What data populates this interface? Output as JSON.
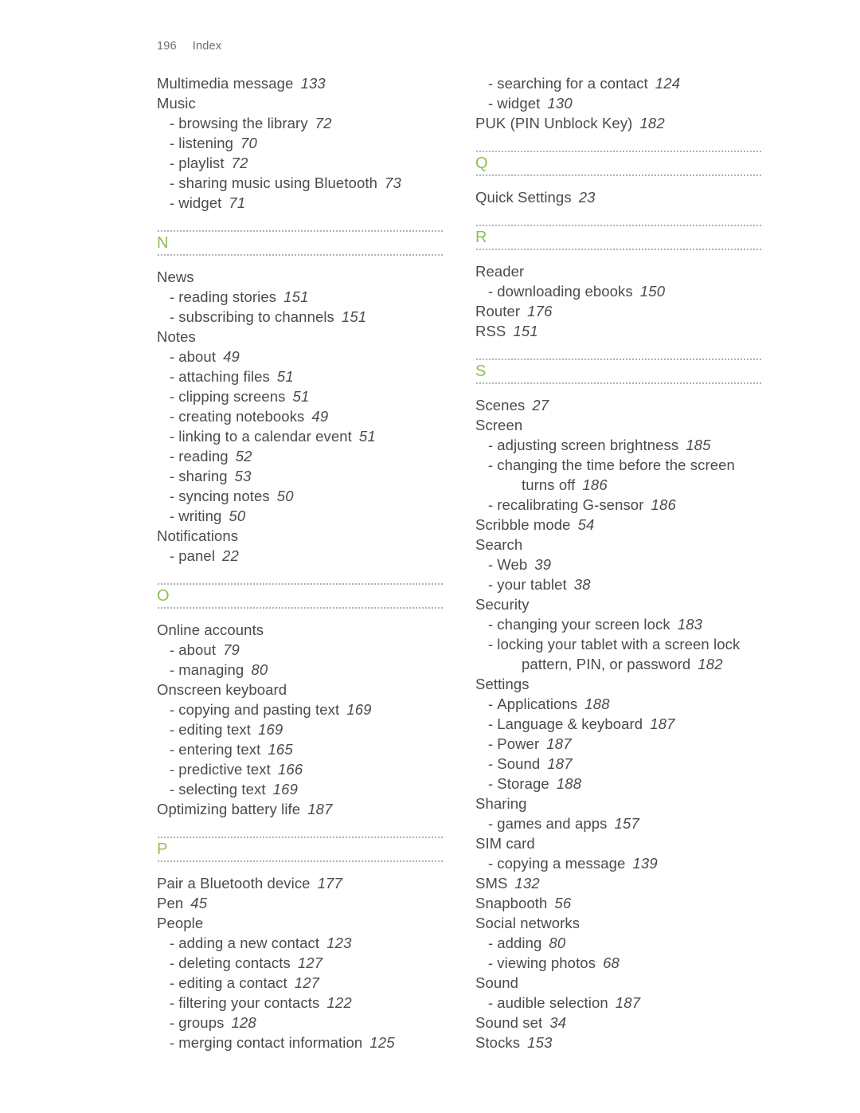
{
  "header": {
    "folio": "196",
    "title": "Index"
  },
  "theme": {
    "letter_color": "#8cc152",
    "text_color": "#4b4b4b",
    "header_color": "#6f6f6f",
    "rule_color": "#6b6b6b"
  },
  "columns": [
    {
      "name": "left-column",
      "blocks": [
        {
          "type": "entries",
          "entries": [
            {
              "level": "main",
              "text": "Multimedia message",
              "page": "133"
            },
            {
              "level": "main",
              "text": "Music",
              "page": ""
            },
            {
              "level": "sub",
              "text": "browsing the library",
              "page": "72"
            },
            {
              "level": "sub",
              "text": "listening",
              "page": "70"
            },
            {
              "level": "sub",
              "text": "playlist",
              "page": "72"
            },
            {
              "level": "sub",
              "text": "sharing music using Bluetooth",
              "page": "73"
            },
            {
              "level": "sub",
              "text": "widget",
              "page": "71"
            }
          ]
        },
        {
          "type": "letter",
          "letter": "N"
        },
        {
          "type": "entries",
          "entries": [
            {
              "level": "main",
              "text": "News",
              "page": ""
            },
            {
              "level": "sub",
              "text": "reading stories",
              "page": "151"
            },
            {
              "level": "sub",
              "text": "subscribing to channels",
              "page": "151"
            },
            {
              "level": "main",
              "text": "Notes",
              "page": ""
            },
            {
              "level": "sub",
              "text": "about",
              "page": "49"
            },
            {
              "level": "sub",
              "text": "attaching files",
              "page": "51"
            },
            {
              "level": "sub",
              "text": "clipping screens",
              "page": "51"
            },
            {
              "level": "sub",
              "text": "creating notebooks",
              "page": "49"
            },
            {
              "level": "sub",
              "text": "linking to a calendar event",
              "page": "51"
            },
            {
              "level": "sub",
              "text": "reading",
              "page": "52"
            },
            {
              "level": "sub",
              "text": "sharing",
              "page": "53"
            },
            {
              "level": "sub",
              "text": "syncing notes",
              "page": "50"
            },
            {
              "level": "sub",
              "text": "writing",
              "page": "50"
            },
            {
              "level": "main",
              "text": "Notifications",
              "page": ""
            },
            {
              "level": "sub",
              "text": "panel",
              "page": "22"
            }
          ]
        },
        {
          "type": "letter",
          "letter": "O"
        },
        {
          "type": "entries",
          "entries": [
            {
              "level": "main",
              "text": "Online accounts",
              "page": ""
            },
            {
              "level": "sub",
              "text": "about",
              "page": "79"
            },
            {
              "level": "sub",
              "text": "managing",
              "page": "80"
            },
            {
              "level": "main",
              "text": "Onscreen keyboard",
              "page": ""
            },
            {
              "level": "sub",
              "text": "copying and pasting text",
              "page": "169"
            },
            {
              "level": "sub",
              "text": "editing text",
              "page": "169"
            },
            {
              "level": "sub",
              "text": "entering text",
              "page": "165"
            },
            {
              "level": "sub",
              "text": "predictive text",
              "page": "166"
            },
            {
              "level": "sub",
              "text": "selecting text",
              "page": "169"
            },
            {
              "level": "main",
              "text": "Optimizing battery life",
              "page": "187"
            }
          ]
        },
        {
          "type": "letter",
          "letter": "P"
        },
        {
          "type": "entries",
          "entries": [
            {
              "level": "main",
              "text": "Pair a Bluetooth device",
              "page": "177"
            },
            {
              "level": "main",
              "text": "Pen",
              "page": "45"
            },
            {
              "level": "main",
              "text": "People",
              "page": ""
            },
            {
              "level": "sub",
              "text": "adding a new contact",
              "page": "123"
            },
            {
              "level": "sub",
              "text": "deleting contacts",
              "page": "127"
            },
            {
              "level": "sub",
              "text": "editing a contact",
              "page": "127"
            },
            {
              "level": "sub",
              "text": "filtering your contacts",
              "page": "122"
            },
            {
              "level": "sub",
              "text": "groups",
              "page": "128"
            },
            {
              "level": "sub",
              "text": "merging contact information",
              "page": "125"
            }
          ]
        }
      ]
    },
    {
      "name": "right-column",
      "blocks": [
        {
          "type": "entries",
          "entries": [
            {
              "level": "sub",
              "text": "searching for a contact",
              "page": "124"
            },
            {
              "level": "sub",
              "text": "widget",
              "page": "130"
            },
            {
              "level": "main",
              "text": "PUK (PIN Unblock Key)",
              "page": "182"
            }
          ]
        },
        {
          "type": "letter",
          "letter": "Q"
        },
        {
          "type": "entries",
          "entries": [
            {
              "level": "main",
              "text": "Quick Settings",
              "page": "23"
            }
          ]
        },
        {
          "type": "letter",
          "letter": "R"
        },
        {
          "type": "entries",
          "entries": [
            {
              "level": "main",
              "text": "Reader",
              "page": ""
            },
            {
              "level": "sub",
              "text": "downloading ebooks",
              "page": "150"
            },
            {
              "level": "main",
              "text": "Router",
              "page": "176"
            },
            {
              "level": "main",
              "text": "RSS",
              "page": "151"
            }
          ]
        },
        {
          "type": "letter",
          "letter": "S"
        },
        {
          "type": "entries",
          "entries": [
            {
              "level": "main",
              "text": "Scenes",
              "page": "27"
            },
            {
              "level": "main",
              "text": "Screen",
              "page": ""
            },
            {
              "level": "sub",
              "text": "adjusting screen brightness",
              "page": "185"
            },
            {
              "level": "sub",
              "text": "changing the time before the screen",
              "page": ""
            },
            {
              "level": "cont",
              "text": "turns off",
              "page": "186"
            },
            {
              "level": "sub",
              "text": "recalibrating G-sensor",
              "page": "186"
            },
            {
              "level": "main",
              "text": "Scribble mode",
              "page": "54"
            },
            {
              "level": "main",
              "text": "Search",
              "page": ""
            },
            {
              "level": "sub",
              "text": "Web",
              "page": "39"
            },
            {
              "level": "sub",
              "text": "your tablet",
              "page": "38"
            },
            {
              "level": "main",
              "text": "Security",
              "page": ""
            },
            {
              "level": "sub",
              "text": "changing your screen lock",
              "page": "183"
            },
            {
              "level": "sub",
              "text": "locking your tablet with a screen lock",
              "page": ""
            },
            {
              "level": "cont",
              "text": "pattern, PIN, or password",
              "page": "182"
            },
            {
              "level": "main",
              "text": "Settings",
              "page": ""
            },
            {
              "level": "sub",
              "text": "Applications",
              "page": "188"
            },
            {
              "level": "sub",
              "text": "Language & keyboard",
              "page": "187"
            },
            {
              "level": "sub",
              "text": "Power",
              "page": "187"
            },
            {
              "level": "sub",
              "text": "Sound",
              "page": "187"
            },
            {
              "level": "sub",
              "text": "Storage",
              "page": "188"
            },
            {
              "level": "main",
              "text": "Sharing",
              "page": ""
            },
            {
              "level": "sub",
              "text": "games and apps",
              "page": "157"
            },
            {
              "level": "main",
              "text": "SIM card",
              "page": ""
            },
            {
              "level": "sub",
              "text": "copying a message",
              "page": "139"
            },
            {
              "level": "main",
              "text": "SMS",
              "page": "132"
            },
            {
              "level": "main",
              "text": "Snapbooth",
              "page": "56"
            },
            {
              "level": "main",
              "text": "Social networks",
              "page": ""
            },
            {
              "level": "sub",
              "text": "adding",
              "page": "80"
            },
            {
              "level": "sub",
              "text": "viewing photos",
              "page": "68"
            },
            {
              "level": "main",
              "text": "Sound",
              "page": ""
            },
            {
              "level": "sub",
              "text": "audible selection",
              "page": "187"
            },
            {
              "level": "main",
              "text": "Sound set",
              "page": "34"
            },
            {
              "level": "main",
              "text": "Stocks",
              "page": "153"
            }
          ]
        }
      ]
    }
  ]
}
